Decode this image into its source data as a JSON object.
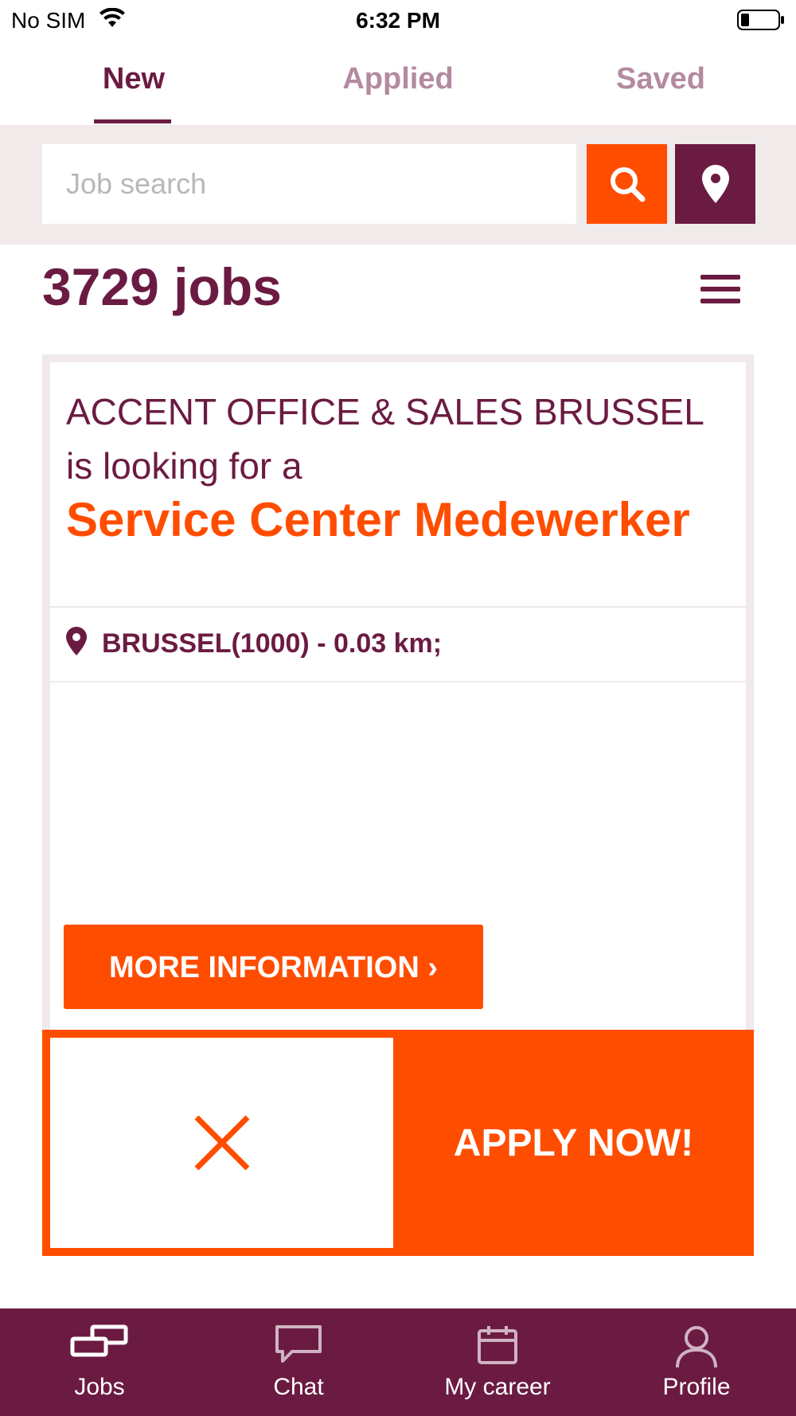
{
  "status_bar": {
    "carrier": "No SIM",
    "time": "6:32 PM"
  },
  "tabs": [
    {
      "label": "New",
      "active": true
    },
    {
      "label": "Applied",
      "active": false
    },
    {
      "label": "Saved",
      "active": false
    }
  ],
  "search": {
    "placeholder": "Job search",
    "value": ""
  },
  "results": {
    "count_label": "3729 jobs"
  },
  "job_card": {
    "company": "ACCENT OFFICE & SALES BRUSSEL",
    "looking_for": "is looking for a",
    "title": "Service Center Medewerker",
    "location": "BRUSSEL(1000) - 0.03 km;",
    "more_info_label": "MORE INFORMATION ›"
  },
  "actions": {
    "apply_label": "APPLY NOW!"
  },
  "bottom_nav": [
    {
      "label": "Jobs",
      "icon": "jobs-icon",
      "active": true
    },
    {
      "label": "Chat",
      "icon": "chat-icon",
      "active": false
    },
    {
      "label": "My career",
      "icon": "calendar-icon",
      "active": false
    },
    {
      "label": "Profile",
      "icon": "profile-icon",
      "active": false
    }
  ],
  "colors": {
    "brand_purple": "#6b1b42",
    "accent_orange": "#ff4d00",
    "inactive_tab": "#b38aa0",
    "band_gray": "#f0eaeb"
  }
}
